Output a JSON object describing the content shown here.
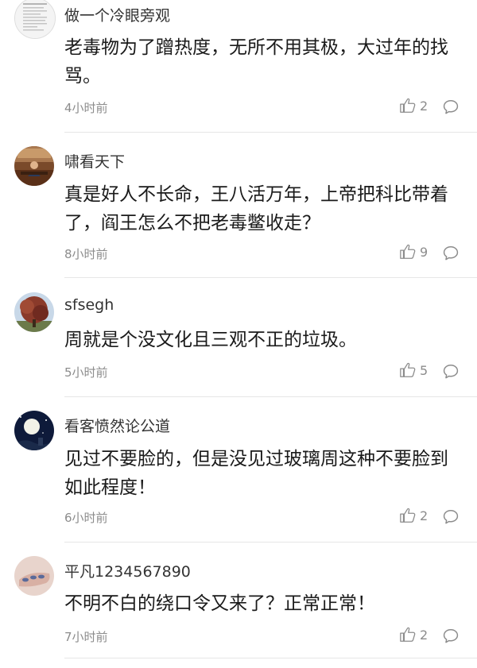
{
  "comments": [
    {
      "username": "做一个冷眼旁观",
      "text": "老毒物为了蹭热度，无所不用其极，大过年的找骂。",
      "time": "4小时前",
      "likes": "2",
      "avatar": "document-thumbnail-avatar"
    },
    {
      "username": "啸看天下",
      "text": "真是好人不长命，王八活万年，上帝把科比带着了，阎王怎么不把老毒鳖收走？",
      "time": "8小时前",
      "likes": "9",
      "avatar": "office-photo-avatar"
    },
    {
      "username": "sfsegh",
      "text": "周就是个没文化且三观不正的垃圾。",
      "time": "5小时前",
      "likes": "5",
      "avatar": "tree-photo-avatar"
    },
    {
      "username": "看客愤然论公道",
      "text": "见过不要脸的，但是没见过玻璃周这种不要脸到如此程度！",
      "time": "6小时前",
      "likes": "2",
      "avatar": "night-moon-avatar"
    },
    {
      "username": "平凡1234567890",
      "text": "不明不白的绕口令又来了？正常正常！",
      "time": "7小时前",
      "likes": "2",
      "avatar": "hand-photo-avatar"
    }
  ],
  "colors": {
    "text": "#1a1a1a",
    "meta": "#8c8c8c",
    "divider": "#e6e6e6",
    "background": "#ffffff"
  },
  "icons": {
    "like": "thumbs-up-icon",
    "reply": "speech-bubble-icon"
  }
}
